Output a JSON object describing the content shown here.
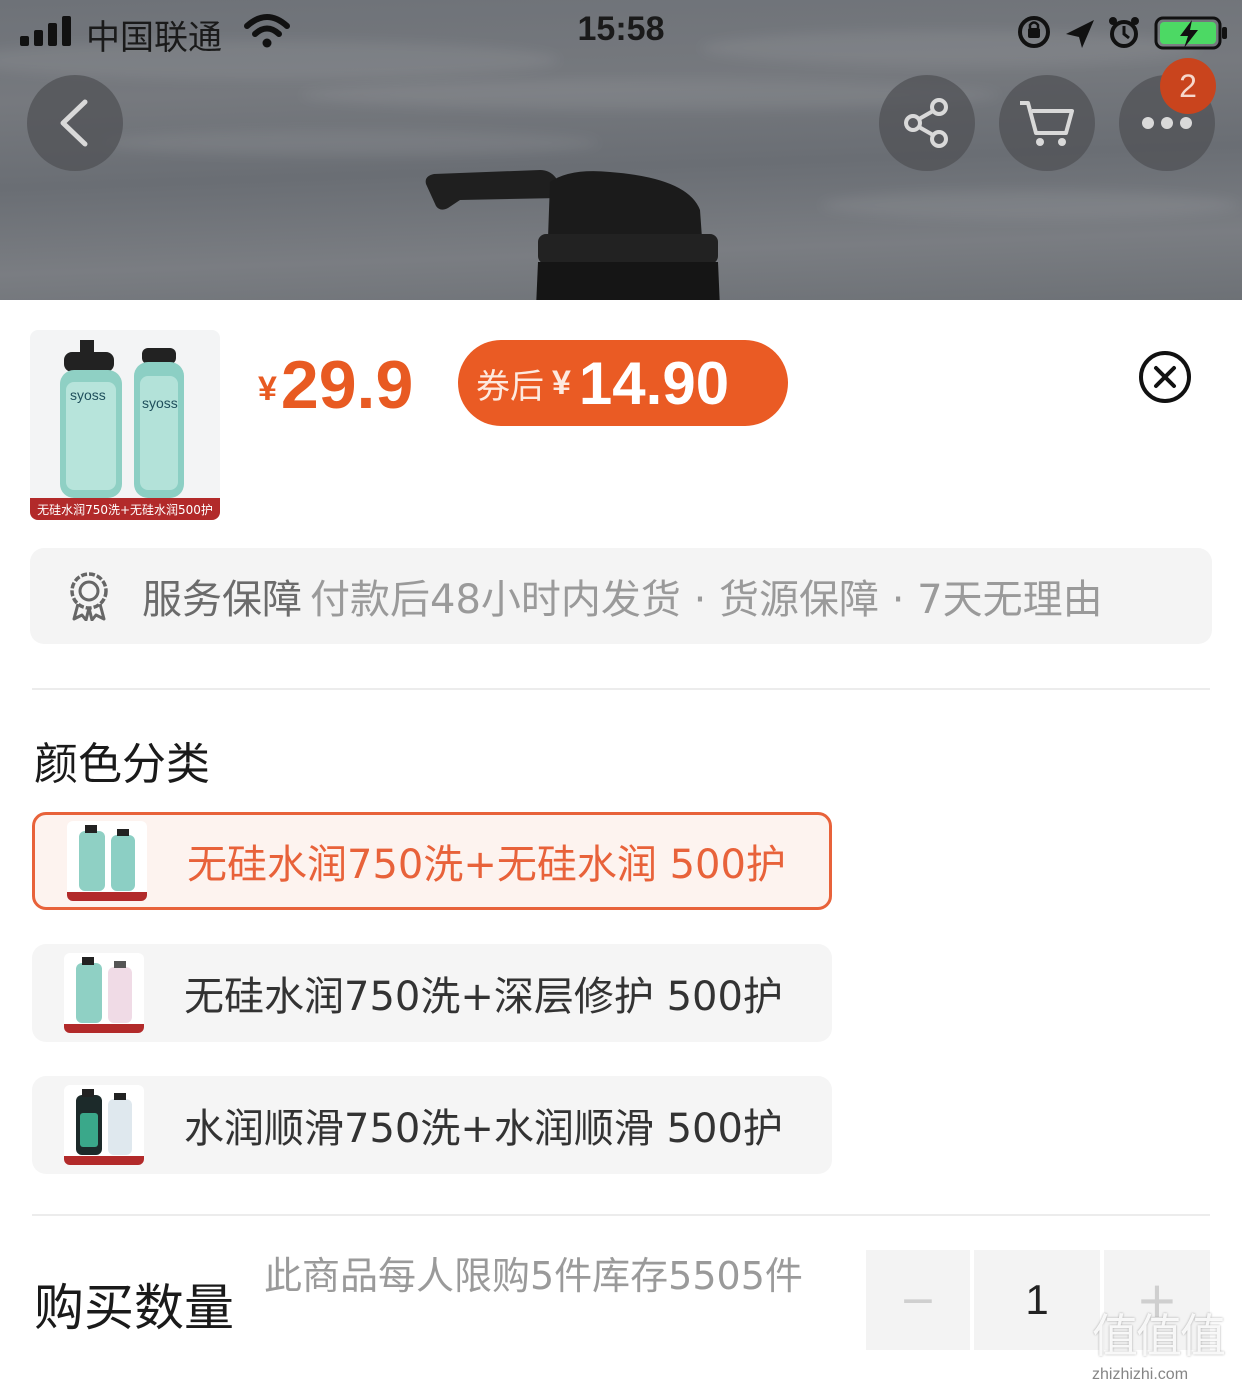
{
  "status_bar": {
    "carrier": "中国联通",
    "time": "15:58"
  },
  "nav": {
    "cart_badge_count": "2"
  },
  "product": {
    "thumbnail_caption": "无硅水润750洗+无硅水润500护",
    "currency": "¥",
    "price": "29.9",
    "coupon_label": "券后",
    "coupon_currency": "¥",
    "coupon_price": "14.90"
  },
  "service": {
    "title": "服务保障",
    "description": "付款后48小时内发货 · 货源保障 · 7天无理由"
  },
  "variants": {
    "title": "颜色分类",
    "options": [
      {
        "label": "无硅水润750洗+无硅水润 500护",
        "selected": true
      },
      {
        "label": "无硅水润750洗+深层修护 500护",
        "selected": false
      },
      {
        "label": "水润顺滑750洗+水润顺滑 500护",
        "selected": false
      }
    ]
  },
  "quantity": {
    "title": "购买数量",
    "note": "此商品每人限购5件库存5505件",
    "value": "1",
    "minus": "−",
    "plus": "+"
  },
  "watermark": {
    "logo": "值值值",
    "site": "zhizhizhi.com"
  },
  "colors": {
    "accent": "#e85a22",
    "badge": "#c9441d",
    "caption_red": "#b22a2a"
  }
}
